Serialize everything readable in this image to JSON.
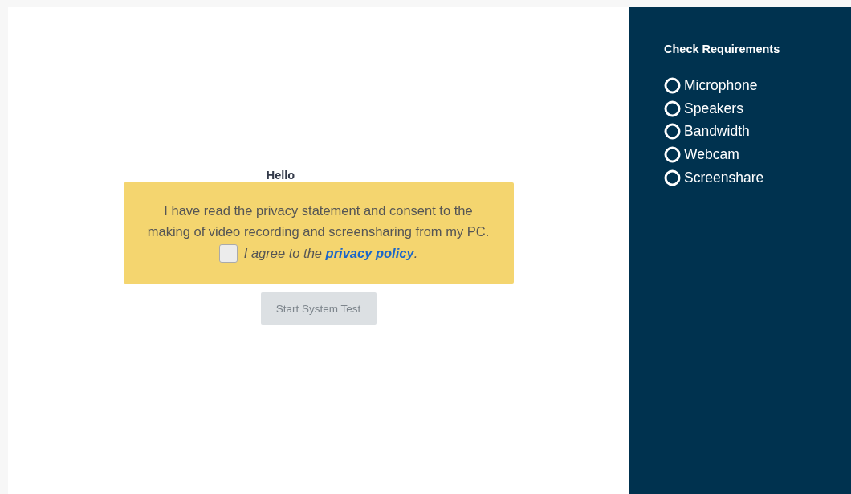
{
  "greeting": "Hello",
  "consent": {
    "statement": "I have read the privacy statement and consent to the making of video recording and screensharing from my PC.",
    "checkbox": {
      "checked": false,
      "label": "I agree to the ",
      "link": "privacy policy",
      "suffix": "."
    }
  },
  "start_button": {
    "label": "Start System Test",
    "disabled": true
  },
  "sidebar": {
    "title": "Check Requirements",
    "items": [
      {
        "label": "Microphone",
        "passed": false
      },
      {
        "label": "Speakers",
        "passed": false
      },
      {
        "label": "Bandwidth",
        "passed": false
      },
      {
        "label": "Webcam",
        "passed": false
      },
      {
        "label": "Screenshare",
        "passed": false
      }
    ]
  }
}
